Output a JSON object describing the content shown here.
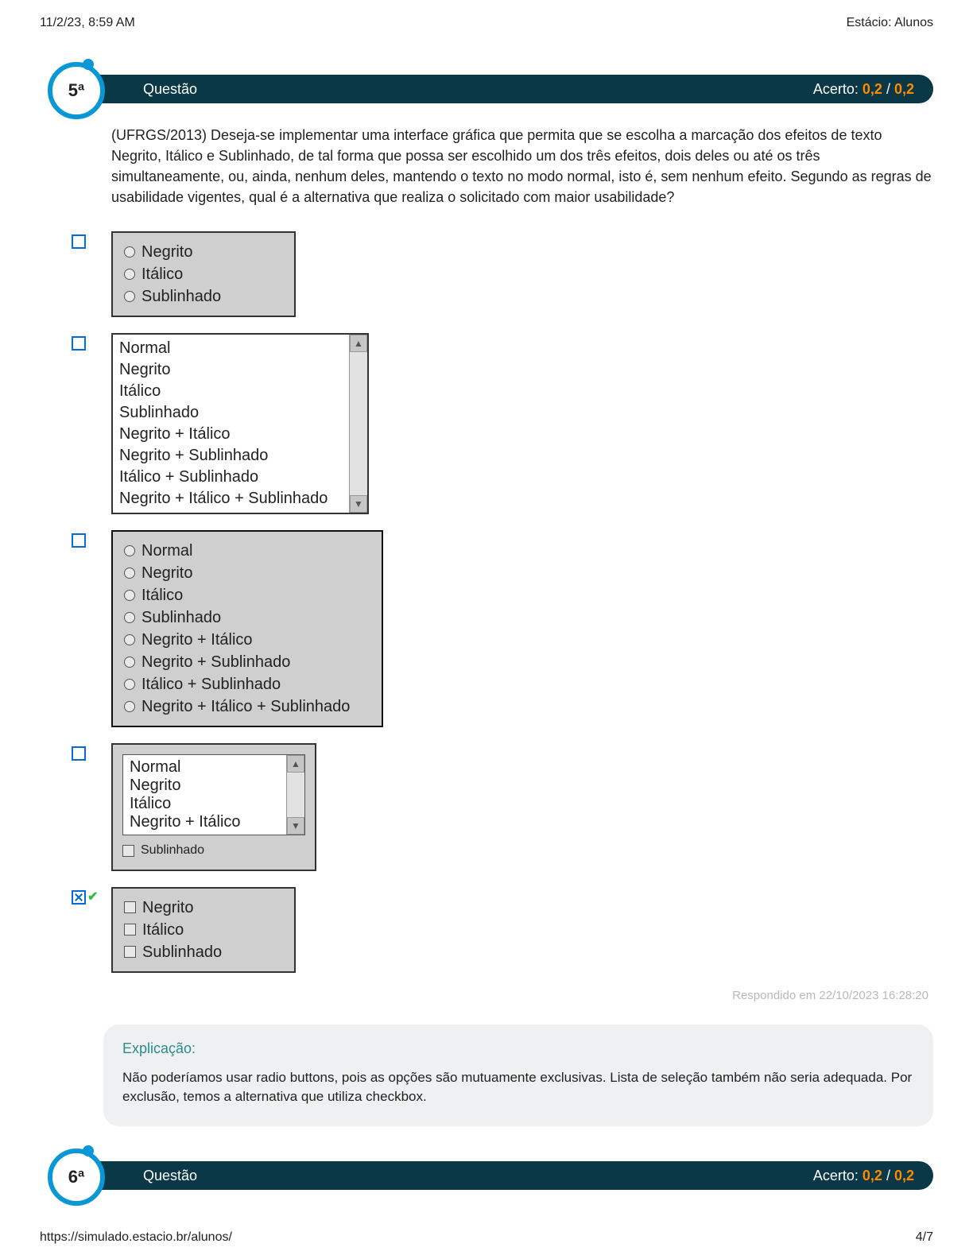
{
  "meta": {
    "timestamp": "11/2/23, 8:59 AM",
    "page_title": "Estácio: Alunos"
  },
  "q5": {
    "number": "5ª",
    "label": "Questão",
    "acerto_label": "Acerto: ",
    "score_got": "0,2",
    "score_sep": " / ",
    "score_max": "0,2",
    "text": "(UFRGS/2013) Deseja-se implementar uma interface gráfica que permita que se escolha a marcação dos efeitos de texto Negrito, Itálico e Sublinhado, de tal forma que possa ser escolhido um dos três efeitos, dois deles ou até os três simultaneamente, ou, ainda, nenhum deles, mantendo o texto no modo normal, isto é, sem nenhum efeito. Segundo as regras de usabilidade vigentes, qual é a alternativa que realiza o solicitado com maior usabilidade?",
    "optA": {
      "items": [
        "Negrito",
        "Itálico",
        "Sublinhado"
      ]
    },
    "optB": {
      "items": [
        "Normal",
        "Negrito",
        "Itálico",
        "Sublinhado",
        "Negrito + Itálico",
        "Negrito + Sublinhado",
        "Itálico + Sublinhado",
        "Negrito + Itálico + Sublinhado"
      ]
    },
    "optC": {
      "items": [
        "Normal",
        "Negrito",
        "Itálico",
        "Sublinhado",
        "Negrito + Itálico",
        "Negrito + Sublinhado",
        "Itálico + Sublinhado",
        "Negrito + Itálico + Sublinhado"
      ]
    },
    "optD": {
      "list": [
        "Normal",
        "Negrito",
        "Itálico",
        "Negrito + Itálico"
      ],
      "check": "Sublinhado"
    },
    "optE": {
      "items": [
        "Negrito",
        "Itálico",
        "Sublinhado"
      ]
    },
    "answered": "Respondido em 22/10/2023 16:28:20",
    "explain_title": "Explicação:",
    "explain_text": "Não poderíamos usar radio buttons, pois as opções são mutuamente exclusivas. Lista de seleção também não seria adequada. Por exclusão, temos a alternativa que utiliza checkbox."
  },
  "q6": {
    "number": "6ª",
    "label": "Questão",
    "acerto_label": "Acerto: ",
    "score_got": "0,2",
    "score_sep": " / ",
    "score_max": "0,2"
  },
  "footer": {
    "url": "https://simulado.estacio.br/alunos/",
    "page": "4/7"
  }
}
